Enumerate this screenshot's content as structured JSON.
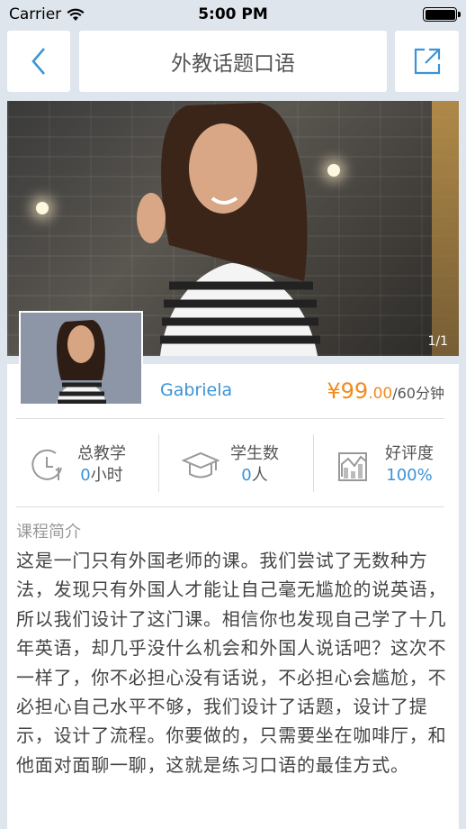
{
  "status_bar": {
    "carrier": "Carrier",
    "time": "5:00 PM",
    "battery_level": 1.0
  },
  "nav": {
    "title": "外教话题口语",
    "back_icon": "chevron-left-icon",
    "share_icon": "share-icon"
  },
  "hero": {
    "counter": "1/1"
  },
  "teacher": {
    "name": "Gabriela"
  },
  "price": {
    "currency": "¥",
    "integer": "99",
    "decimal": ".00",
    "unit": "/60分钟"
  },
  "stats": [
    {
      "label": "总教学",
      "value": "0",
      "unit": "小时",
      "icon": "clock-icon"
    },
    {
      "label": "学生数",
      "value": "0",
      "unit": "人",
      "icon": "graduation-cap-icon"
    },
    {
      "label": "好评度",
      "value": "100",
      "unit": "%",
      "icon": "chart-icon"
    }
  ],
  "intro": {
    "label": "课程简介",
    "text": "这是一门只有外国老师的课。我们尝试了无数种方法，发现只有外国人才能让自己毫无尴尬的说英语，所以我们设计了这门课。相信你也发现自己学了十几年英语，却几乎没什么机会和外国人说话吧？这次不一样了，你不必担心没有话说，不必担心会尴尬，不必担心自己水平不够，我们设计了话题，设计了提示，设计了流程。你要做的，只需要坐在咖啡厅，和他面对面聊一聊，这就是练习口语的最佳方式。"
  },
  "colors": {
    "accent_blue": "#3b93d6",
    "price_orange": "#f28b1e",
    "background": "#dfe5ec"
  }
}
